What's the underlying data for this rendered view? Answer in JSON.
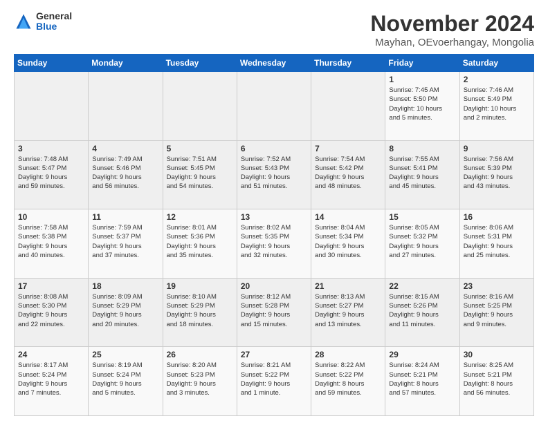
{
  "logo": {
    "general": "General",
    "blue": "Blue"
  },
  "header": {
    "title": "November 2024",
    "subtitle": "Mayhan, OEvoerhangay, Mongolia"
  },
  "weekdays": [
    "Sunday",
    "Monday",
    "Tuesday",
    "Wednesday",
    "Thursday",
    "Friday",
    "Saturday"
  ],
  "weeks": [
    [
      {
        "day": "",
        "info": ""
      },
      {
        "day": "",
        "info": ""
      },
      {
        "day": "",
        "info": ""
      },
      {
        "day": "",
        "info": ""
      },
      {
        "day": "",
        "info": ""
      },
      {
        "day": "1",
        "info": "Sunrise: 7:45 AM\nSunset: 5:50 PM\nDaylight: 10 hours\nand 5 minutes."
      },
      {
        "day": "2",
        "info": "Sunrise: 7:46 AM\nSunset: 5:49 PM\nDaylight: 10 hours\nand 2 minutes."
      }
    ],
    [
      {
        "day": "3",
        "info": "Sunrise: 7:48 AM\nSunset: 5:47 PM\nDaylight: 9 hours\nand 59 minutes."
      },
      {
        "day": "4",
        "info": "Sunrise: 7:49 AM\nSunset: 5:46 PM\nDaylight: 9 hours\nand 56 minutes."
      },
      {
        "day": "5",
        "info": "Sunrise: 7:51 AM\nSunset: 5:45 PM\nDaylight: 9 hours\nand 54 minutes."
      },
      {
        "day": "6",
        "info": "Sunrise: 7:52 AM\nSunset: 5:43 PM\nDaylight: 9 hours\nand 51 minutes."
      },
      {
        "day": "7",
        "info": "Sunrise: 7:54 AM\nSunset: 5:42 PM\nDaylight: 9 hours\nand 48 minutes."
      },
      {
        "day": "8",
        "info": "Sunrise: 7:55 AM\nSunset: 5:41 PM\nDaylight: 9 hours\nand 45 minutes."
      },
      {
        "day": "9",
        "info": "Sunrise: 7:56 AM\nSunset: 5:39 PM\nDaylight: 9 hours\nand 43 minutes."
      }
    ],
    [
      {
        "day": "10",
        "info": "Sunrise: 7:58 AM\nSunset: 5:38 PM\nDaylight: 9 hours\nand 40 minutes."
      },
      {
        "day": "11",
        "info": "Sunrise: 7:59 AM\nSunset: 5:37 PM\nDaylight: 9 hours\nand 37 minutes."
      },
      {
        "day": "12",
        "info": "Sunrise: 8:01 AM\nSunset: 5:36 PM\nDaylight: 9 hours\nand 35 minutes."
      },
      {
        "day": "13",
        "info": "Sunrise: 8:02 AM\nSunset: 5:35 PM\nDaylight: 9 hours\nand 32 minutes."
      },
      {
        "day": "14",
        "info": "Sunrise: 8:04 AM\nSunset: 5:34 PM\nDaylight: 9 hours\nand 30 minutes."
      },
      {
        "day": "15",
        "info": "Sunrise: 8:05 AM\nSunset: 5:32 PM\nDaylight: 9 hours\nand 27 minutes."
      },
      {
        "day": "16",
        "info": "Sunrise: 8:06 AM\nSunset: 5:31 PM\nDaylight: 9 hours\nand 25 minutes."
      }
    ],
    [
      {
        "day": "17",
        "info": "Sunrise: 8:08 AM\nSunset: 5:30 PM\nDaylight: 9 hours\nand 22 minutes."
      },
      {
        "day": "18",
        "info": "Sunrise: 8:09 AM\nSunset: 5:29 PM\nDaylight: 9 hours\nand 20 minutes."
      },
      {
        "day": "19",
        "info": "Sunrise: 8:10 AM\nSunset: 5:29 PM\nDaylight: 9 hours\nand 18 minutes."
      },
      {
        "day": "20",
        "info": "Sunrise: 8:12 AM\nSunset: 5:28 PM\nDaylight: 9 hours\nand 15 minutes."
      },
      {
        "day": "21",
        "info": "Sunrise: 8:13 AM\nSunset: 5:27 PM\nDaylight: 9 hours\nand 13 minutes."
      },
      {
        "day": "22",
        "info": "Sunrise: 8:15 AM\nSunset: 5:26 PM\nDaylight: 9 hours\nand 11 minutes."
      },
      {
        "day": "23",
        "info": "Sunrise: 8:16 AM\nSunset: 5:25 PM\nDaylight: 9 hours\nand 9 minutes."
      }
    ],
    [
      {
        "day": "24",
        "info": "Sunrise: 8:17 AM\nSunset: 5:24 PM\nDaylight: 9 hours\nand 7 minutes."
      },
      {
        "day": "25",
        "info": "Sunrise: 8:19 AM\nSunset: 5:24 PM\nDaylight: 9 hours\nand 5 minutes."
      },
      {
        "day": "26",
        "info": "Sunrise: 8:20 AM\nSunset: 5:23 PM\nDaylight: 9 hours\nand 3 minutes."
      },
      {
        "day": "27",
        "info": "Sunrise: 8:21 AM\nSunset: 5:22 PM\nDaylight: 9 hours\nand 1 minute."
      },
      {
        "day": "28",
        "info": "Sunrise: 8:22 AM\nSunset: 5:22 PM\nDaylight: 8 hours\nand 59 minutes."
      },
      {
        "day": "29",
        "info": "Sunrise: 8:24 AM\nSunset: 5:21 PM\nDaylight: 8 hours\nand 57 minutes."
      },
      {
        "day": "30",
        "info": "Sunrise: 8:25 AM\nSunset: 5:21 PM\nDaylight: 8 hours\nand 56 minutes."
      }
    ]
  ]
}
